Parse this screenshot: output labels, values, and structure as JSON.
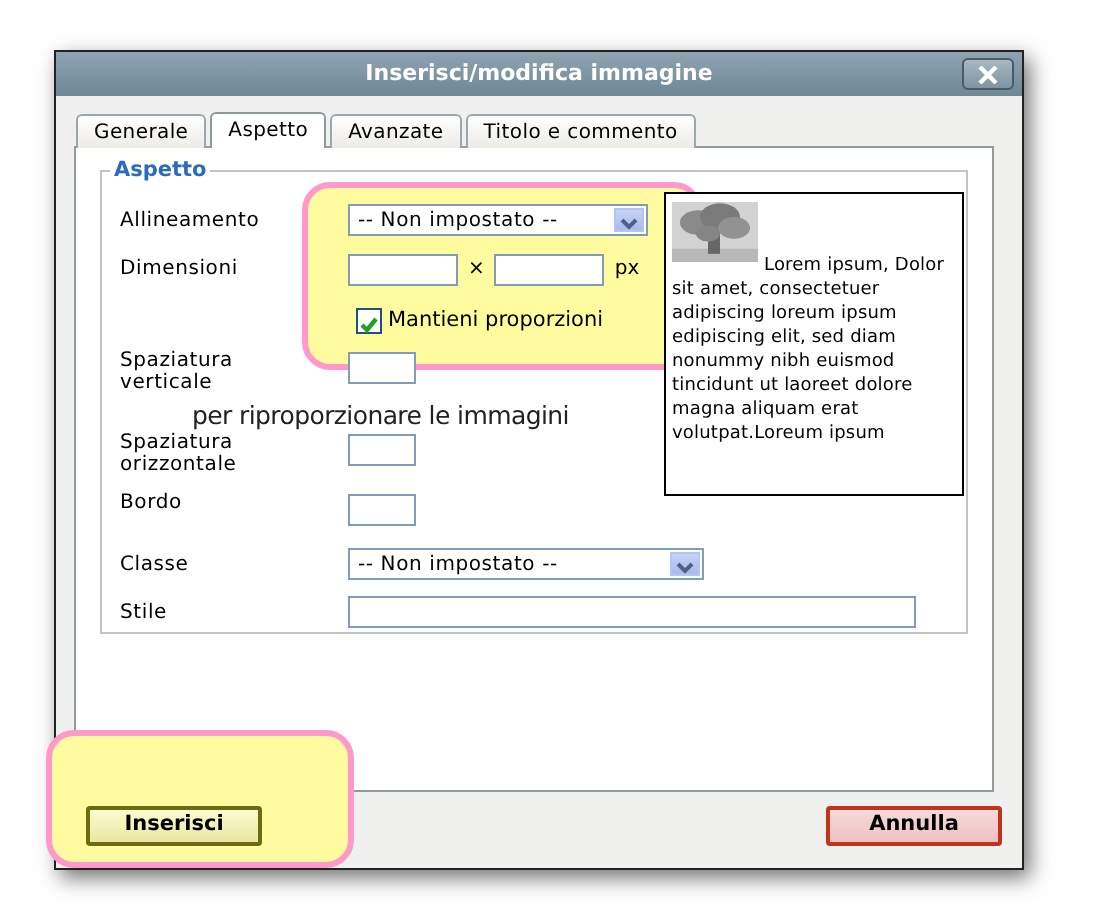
{
  "window": {
    "title": "Inserisci/modifica immagine"
  },
  "tabs": [
    {
      "label": "Generale",
      "selected": false
    },
    {
      "label": "Aspetto",
      "selected": true
    },
    {
      "label": "Avanzate",
      "selected": false
    },
    {
      "label": "Titolo e commento",
      "selected": false
    }
  ],
  "fieldset": {
    "legend": "Aspetto",
    "fields": [
      {
        "kind": "select",
        "label": "Allineamento",
        "value": "-- Non impostato --",
        "highlighted": true
      },
      {
        "kind": "dimensions",
        "label": "Dimensioni",
        "separator": "×",
        "unit": "px",
        "highlighted": true
      },
      {
        "kind": "checkbox",
        "text": "Mantieni proporzioni",
        "checked": true,
        "highlighted": true
      },
      {
        "kind": "small",
        "label": "Spaziatura verticale",
        "highlighted": false
      },
      {
        "kind": "small",
        "label": "Spaziatura orizzontale",
        "highlighted": false
      },
      {
        "kind": "small",
        "label": "Bordo",
        "highlighted": false
      },
      {
        "kind": "select",
        "label": "Classe",
        "value": "-- Non impostato --",
        "highlighted": false
      },
      {
        "kind": "text",
        "label": "Stile",
        "highlighted": false
      }
    ],
    "preview": {
      "text": "Lorem ipsum, Dolor sit amet, consectetuer adipiscing loreum ipsum edipiscing elit, sed diam nonummy nibh euismod tincidunt ut laoreet dolore magna aliquam erat volutpat.Loreum ipsum"
    }
  },
  "annotation": {
    "text": "per riproporzionare le immagini"
  },
  "buttons": [
    {
      "label": "Inserisci",
      "kind": "insert",
      "highlighted": true
    },
    {
      "label": "Annulla",
      "kind": "cancel",
      "highlighted": false
    }
  ]
}
